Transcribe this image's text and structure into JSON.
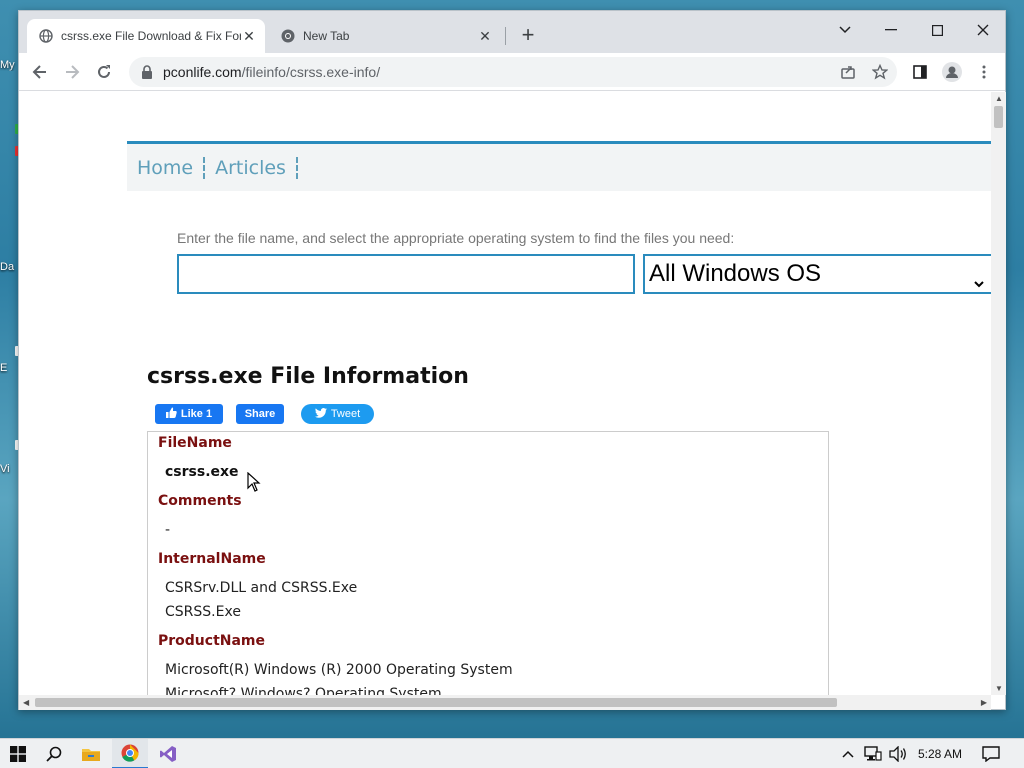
{
  "desktop": {
    "labels": [
      "My",
      "Da",
      "E",
      "Vi"
    ]
  },
  "browser": {
    "tabs": [
      {
        "title": "csrss.exe File Download & Fix For",
        "active": true
      },
      {
        "title": "New Tab",
        "active": false
      }
    ],
    "url_host": "pconlife.com",
    "url_path": "/fileinfo/csrss.exe-info/"
  },
  "page": {
    "nav": [
      "Home",
      "Articles"
    ],
    "search_hint": "Enter the file name, and select the appropriate operating system to find the files you need:",
    "search_value": "",
    "os_selected": "All Windows OS",
    "title": "csrss.exe File Information",
    "social": {
      "like": "Like 1",
      "share": "Share",
      "tweet": "Tweet"
    },
    "info": [
      {
        "key": "FileName",
        "values": [
          "csrss.exe"
        ]
      },
      {
        "key": "Comments",
        "values": [
          "-"
        ]
      },
      {
        "key": "InternalName",
        "values": [
          "CSRSrv.DLL and CSRSS.Exe",
          "CSRSS.Exe"
        ]
      },
      {
        "key": "ProductName",
        "values": [
          "Microsoft(R) Windows (R) 2000 Operating System",
          "Microsoft? Windows? Operating System"
        ]
      }
    ]
  },
  "taskbar": {
    "time": "5:28 AM"
  },
  "colors": {
    "accent": "#2a8bbd",
    "nav_link": "#5f9fba",
    "info_key": "#7a1010"
  }
}
